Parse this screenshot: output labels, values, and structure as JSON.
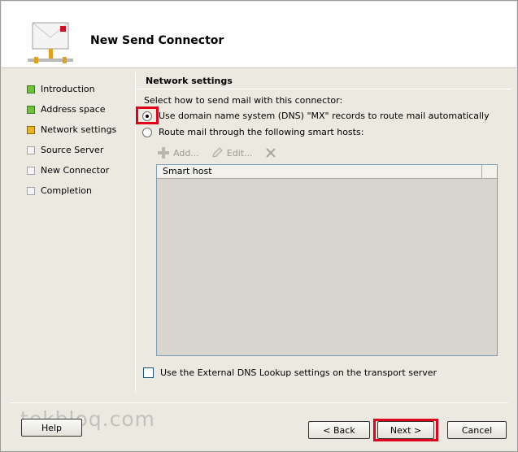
{
  "wizard": {
    "title": "New Send Connector"
  },
  "nav": {
    "items": [
      {
        "label": "Introduction",
        "status": "done"
      },
      {
        "label": "Address space",
        "status": "done"
      },
      {
        "label": "Network settings",
        "status": "current"
      },
      {
        "label": "Source Server",
        "status": "pending"
      },
      {
        "label": "New Connector",
        "status": "pending"
      },
      {
        "label": "Completion",
        "status": "pending"
      }
    ]
  },
  "network": {
    "section_title": "Network settings",
    "prompt": "Select how to send mail with this connector:",
    "option_dns": "Use domain name system (DNS) \"MX\" records to route mail automatically",
    "option_smart": "Route mail through the following smart hosts:",
    "selected": "dns",
    "toolbar": {
      "add_label": "Add...",
      "edit_label": "Edit..."
    },
    "list": {
      "column": "Smart host",
      "rows": []
    },
    "external_dns_label": "Use the External DNS Lookup settings on the transport server",
    "external_dns_checked": false
  },
  "buttons": {
    "help": "Help",
    "back": "< Back",
    "next": "Next >",
    "cancel": "Cancel"
  },
  "watermark": "tekbloq.com",
  "colors": {
    "done": "#6fc13c",
    "current": "#e8b624",
    "highlight": "#e0001b"
  }
}
